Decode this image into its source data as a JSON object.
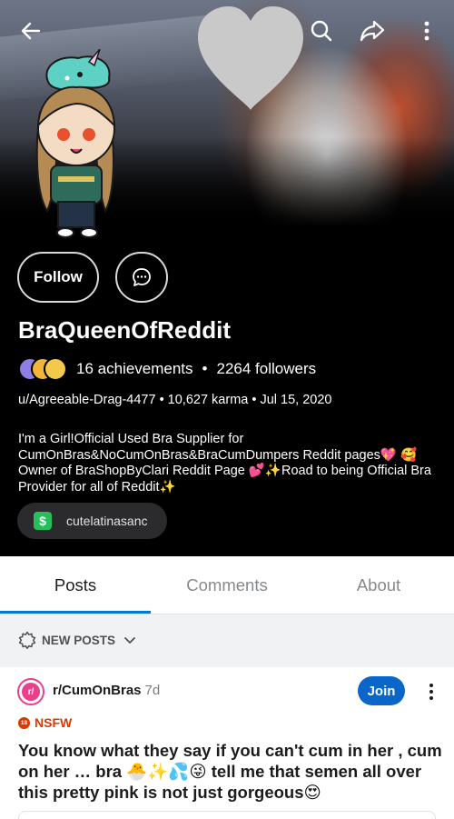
{
  "profile": {
    "username": "BraQueenOfReddit",
    "achievements": "16 achievements",
    "followers": "2264 followers",
    "separator": "•",
    "handle_line": "u/Agreeable-Drag-4477 • 10,627 karma • Jul 15, 2020",
    "bio_lines": [
      "I'm a Girl!Official Used Bra Supplier for",
      "CumOnBras&NoCumOnBras&BraCumDumpers Reddit pages💖 🥰",
      "Owner of BraShopByClari Reddit Page 💕✨Road to being Official Bra",
      "Provider for all of Reddit✨"
    ],
    "cashtag": "cutelatinasanc",
    "cash_symbol": "$",
    "follow_label": "Follow"
  },
  "icons": {
    "back": "arrow-left-icon",
    "search": "search-icon",
    "share": "share-icon",
    "more": "more-vertical-icon",
    "chat": "chat-icon",
    "sort": "sort-burst-icon",
    "chevron": "chevron-down-icon"
  },
  "tabs": [
    {
      "label": "Posts",
      "active": true
    },
    {
      "label": "Comments",
      "active": false
    },
    {
      "label": "About",
      "active": false
    }
  ],
  "sort": {
    "label": "NEW POSTS"
  },
  "post": {
    "subreddit": "r/CumOnBras",
    "age": "7d",
    "join_label": "Join",
    "nsfw_label": "NSFW",
    "nsfw_badge": "18",
    "sub_icon_text": "r/",
    "title_lines": [
      "You know what they say if you can't cum in her , cum",
      "on her … bra 🐣✨💦😜 tell me that semen all over",
      "this pretty pink is not just gorgeous😍"
    ]
  },
  "colors": {
    "accent": "#0079d3",
    "join": "#0a66c8",
    "nsfw": "#d93a00",
    "cash": "#25c05a",
    "header_bg": "#000000"
  }
}
